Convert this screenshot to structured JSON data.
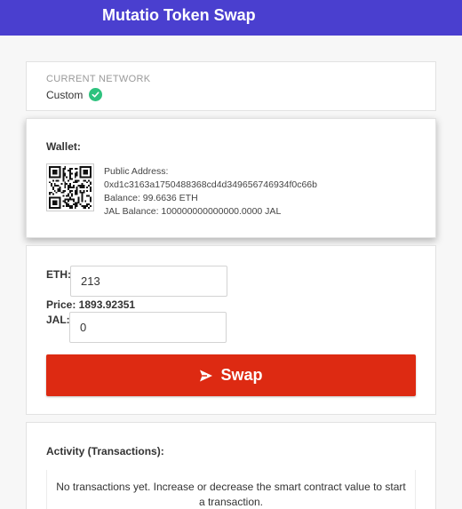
{
  "header": {
    "title": "Mutatio Token Swap",
    "color": "#4a3fcf"
  },
  "network": {
    "label": "CURRENT NETWORK",
    "value": "Custom",
    "status_icon": "check-circle-icon"
  },
  "wallet": {
    "label": "Wallet:",
    "qr_icon": "qr-code-icon",
    "public_address_label": "Public Address:",
    "address": "0xd1c3163a1750488368cd4d349656746934f0c66b",
    "balance": "Balance: 99.6636 ETH",
    "jal_balance": "JAL Balance: 100000000000000.0000 JAL"
  },
  "swap": {
    "eth_label": "ETH:",
    "eth_value": "213",
    "price": "Price: 1893.92351",
    "jal_label": "JAL:",
    "jal_value": "0",
    "button_label": "Swap",
    "button_icon": "send-icon",
    "button_color": "#dd2a12"
  },
  "activity": {
    "label": "Activity (Transactions):",
    "empty_message": "No transactions yet. Increase or decrease the smart contract value to start a transaction."
  }
}
